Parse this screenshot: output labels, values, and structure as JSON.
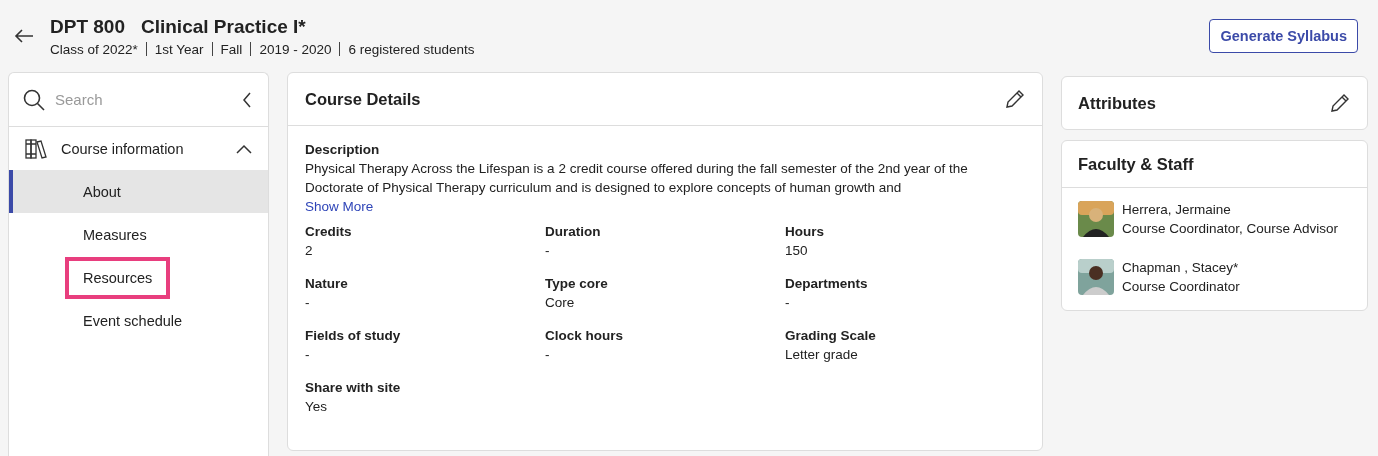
{
  "header": {
    "code": "DPT 800",
    "title": "Clinical Practice I*",
    "meta": [
      "Class of 2022*",
      "1st Year",
      "Fall",
      "2019 - 2020",
      "6 registered students"
    ],
    "button": "Generate Syllabus"
  },
  "sidebar": {
    "search": {
      "placeholder": "Search"
    },
    "section": {
      "label": "Course information",
      "expanded": true,
      "items": [
        {
          "label": "About",
          "selected": true,
          "highlighted": false
        },
        {
          "label": "Measures",
          "selected": false,
          "highlighted": false
        },
        {
          "label": "Resources",
          "selected": false,
          "highlighted": true
        },
        {
          "label": "Event schedule",
          "selected": false,
          "highlighted": false
        }
      ]
    }
  },
  "course_details": {
    "title": "Course Details",
    "description_label": "Description",
    "description": "Physical Therapy Across the Lifespan is a 2 credit course offered during the fall semester of the 2nd year of the Doctorate of Physical Therapy curriculum and is designed to explore concepts of human growth and",
    "show_more": "Show More",
    "fields": [
      {
        "label": "Credits",
        "value": "2"
      },
      {
        "label": "Duration",
        "value": "-"
      },
      {
        "label": "Hours",
        "value": "150"
      },
      {
        "label": "Nature",
        "value": "-"
      },
      {
        "label": "Type core",
        "value": "Core"
      },
      {
        "label": "Departments",
        "value": "-"
      },
      {
        "label": "Fields of study",
        "value": "-"
      },
      {
        "label": "Clock hours",
        "value": "-"
      },
      {
        "label": "Grading Scale",
        "value": "Letter grade"
      },
      {
        "label": "Share with site",
        "value": "Yes"
      }
    ]
  },
  "attributes": {
    "title": "Attributes"
  },
  "faculty": {
    "title": "Faculty & Staff",
    "people": [
      {
        "name": "Herrera, Jermaine",
        "role": "Course Coordinator, Course Advisor"
      },
      {
        "name": "Chapman , Stacey*",
        "role": "Course Coordinator"
      }
    ]
  }
}
